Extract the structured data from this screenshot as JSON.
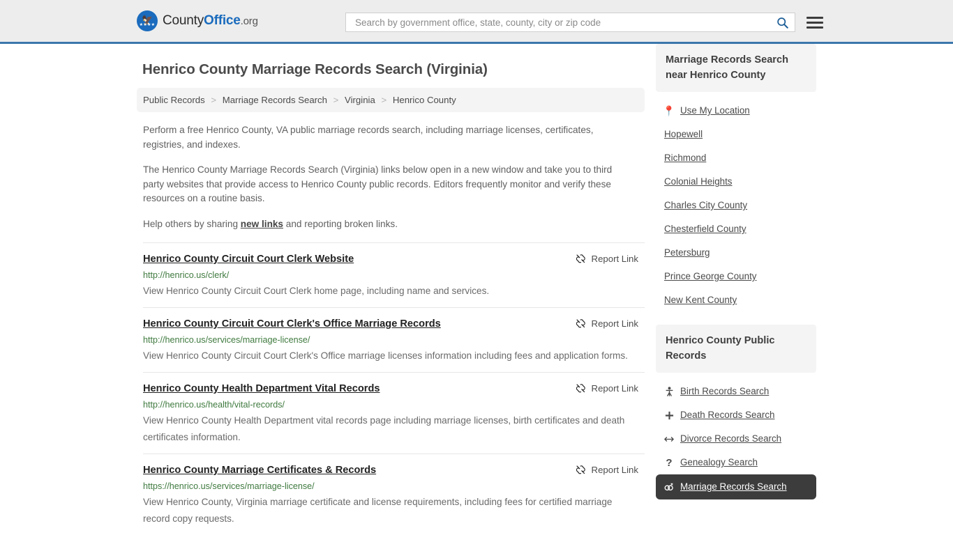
{
  "header": {
    "logo": {
      "part1": "County",
      "part2": "Office",
      "tld": ".org",
      "icon": "eagle-seal-icon"
    },
    "search": {
      "placeholder": "Search by government office, state, county, city or zip code",
      "value": "",
      "search_icon": "search-icon"
    },
    "menu_icon": "hamburger-menu-icon"
  },
  "main": {
    "title": "Henrico County Marriage Records Search (Virginia)",
    "breadcrumb": [
      {
        "label": "Public Records",
        "current": false
      },
      {
        "label": "Marriage Records Search",
        "current": false
      },
      {
        "label": "Virginia",
        "current": false
      },
      {
        "label": "Henrico County",
        "current": true
      }
    ],
    "breadcrumb_separator": ">",
    "intro_paragraph_1": "Perform a free Henrico County, VA public marriage records search, including marriage licenses, certificates, registries, and indexes.",
    "intro_paragraph_2": "The Henrico County Marriage Records Search (Virginia) links below open in a new window and take you to third party websites that provide access to Henrico County public records. Editors frequently monitor and verify these resources on a routine basis.",
    "intro_paragraph_3_before": "Help others by sharing ",
    "intro_paragraph_3_link": "new links",
    "intro_paragraph_3_after": " and reporting broken links.",
    "report_link_label": "Report Link",
    "report_link_icon": "broken-link-icon",
    "listings": [
      {
        "title": "Henrico County Circuit Court Clerk Website",
        "url": "http://henrico.us/clerk/",
        "description": "View Henrico County Circuit Court Clerk home page, including name and services."
      },
      {
        "title": "Henrico County Circuit Court Clerk's Office Marriage Records",
        "url": "http://henrico.us/services/marriage-license/",
        "description": "View Henrico County Circuit Court Clerk's Office marriage licenses information including fees and application forms."
      },
      {
        "title": "Henrico County Health Department Vital Records",
        "url": "http://henrico.us/health/vital-records/",
        "description": "View Henrico County Health Department vital records page including marriage licenses, birth certificates and death certificates information."
      },
      {
        "title": "Henrico County Marriage Certificates & Records",
        "url": "https://henrico.us/services/marriage-license/",
        "description": "View Henrico County, Virginia marriage certificate and license requirements, including fees for certified marriage record copy requests."
      }
    ]
  },
  "sidebar": {
    "panel_nearby": {
      "title": "Marriage Records Search near Henrico County",
      "items": [
        {
          "label": "Use My Location",
          "icon": "map-pin-icon",
          "active": false
        },
        {
          "label": "Hopewell",
          "icon": "",
          "active": false
        },
        {
          "label": "Richmond",
          "icon": "",
          "active": false
        },
        {
          "label": "Colonial Heights",
          "icon": "",
          "active": false
        },
        {
          "label": "Charles City County",
          "icon": "",
          "active": false
        },
        {
          "label": "Chesterfield County",
          "icon": "",
          "active": false
        },
        {
          "label": "Petersburg",
          "icon": "",
          "active": false
        },
        {
          "label": "Prince George County",
          "icon": "",
          "active": false
        },
        {
          "label": "New Kent County",
          "icon": "",
          "active": false
        }
      ]
    },
    "panel_public_records": {
      "title": "Henrico County Public Records",
      "items": [
        {
          "label": "Birth Records Search",
          "icon": "baby-icon",
          "glyph": "Ɣ",
          "active": false
        },
        {
          "label": "Death Records Search",
          "icon": "cross-icon",
          "glyph": "✚",
          "active": false
        },
        {
          "label": "Divorce Records Search",
          "icon": "left-right-arrow-icon",
          "glyph": "↔",
          "active": false
        },
        {
          "label": "Genealogy Search",
          "icon": "question-mark-icon",
          "glyph": "?",
          "active": false
        },
        {
          "label": "Marriage Records Search",
          "icon": "rings-icon",
          "glyph": "⚭",
          "active": true
        }
      ]
    }
  },
  "colors": {
    "header_bg": "#ededed",
    "header_border": "#3b76ab",
    "brand_blue": "#1a6bbd",
    "url_green": "#3f7a3f",
    "panel_head_bg": "#f4f4f4",
    "active_bg": "#3c3c3c"
  }
}
